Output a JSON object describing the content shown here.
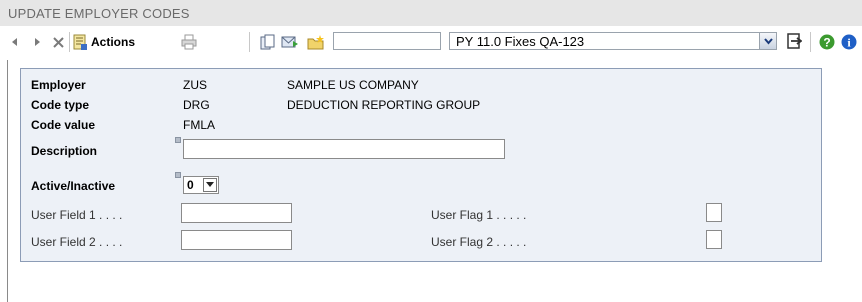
{
  "window": {
    "title": "UPDATE EMPLOYER CODES"
  },
  "toolbar": {
    "actions_label": "Actions",
    "search_value": "",
    "combo_value": "PY 11.0 Fixes QA-123"
  },
  "form": {
    "employer": {
      "label": "Employer",
      "code": "ZUS",
      "name": "SAMPLE US COMPANY"
    },
    "code_type": {
      "label": "Code type",
      "code": "DRG",
      "name": "DEDUCTION REPORTING GROUP"
    },
    "code_value": {
      "label": "Code value",
      "value": "FMLA"
    },
    "description": {
      "label": "Description",
      "value": ""
    },
    "active": {
      "label": "Active/Inactive",
      "value": "0"
    },
    "user_field_1": {
      "label": "User Field 1 . . . .",
      "value": ""
    },
    "user_field_2": {
      "label": "User Field 2 . . . .",
      "value": ""
    },
    "user_flag_1": {
      "label": "User Flag 1 . . . . .",
      "checked": false
    },
    "user_flag_2": {
      "label": "User Flag 2 . . . . .",
      "checked": false
    }
  },
  "colors": {
    "panel_bg": "#edf1f7",
    "panel_border": "#8c9cb6",
    "title_bar": "#e6e6e6"
  }
}
